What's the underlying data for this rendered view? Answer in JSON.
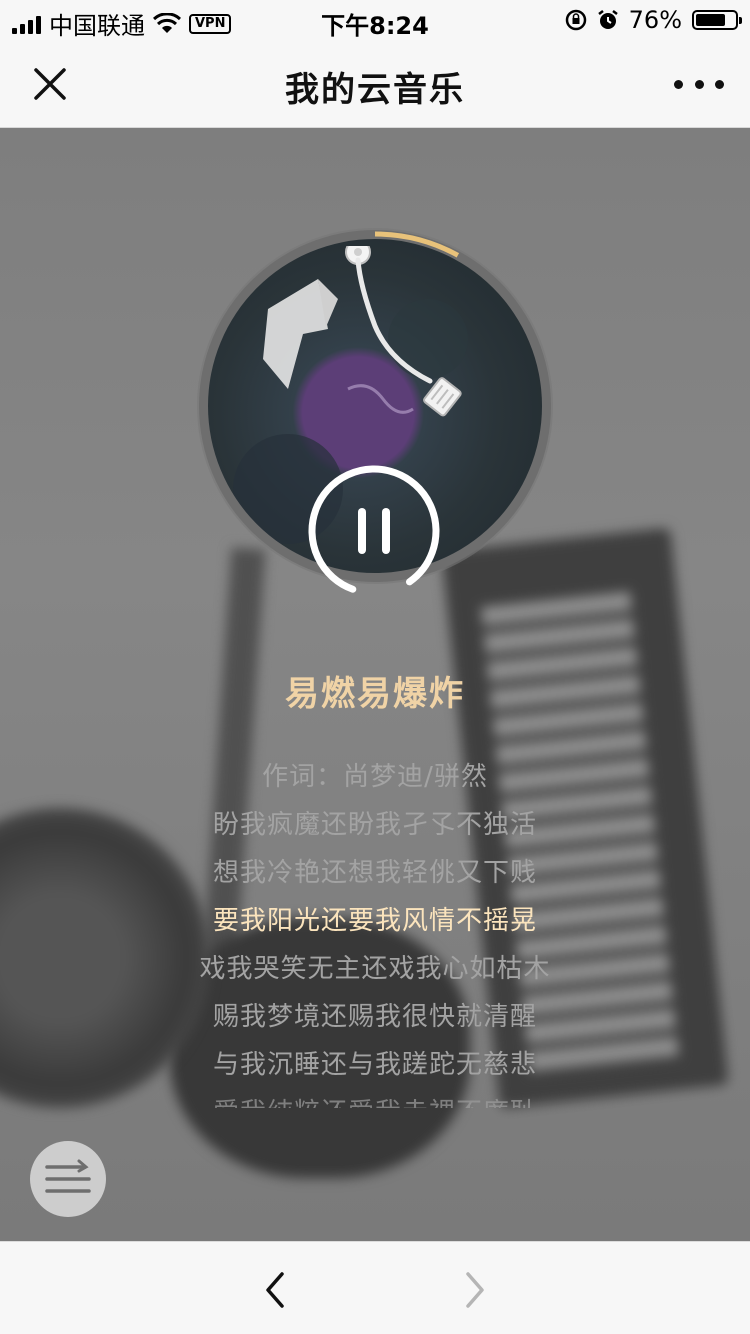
{
  "status_bar": {
    "carrier": "中国联通",
    "vpn": "VPN",
    "time": "下午8:24",
    "battery_text": "76%",
    "battery_level": 0.76
  },
  "nav": {
    "title": "我的云音乐"
  },
  "player": {
    "song_title": "易燃易爆炸",
    "lyrics": [
      "作词：尚梦迪/骈然",
      "盼我疯魔还盼我孑孓不独活",
      "想我冷艳还想我轻佻又下贱",
      "要我阳光还要我风情不摇晃",
      "戏我哭笑无主还戏我心如枯木",
      "赐我梦境还赐我很快就清醒",
      "与我沉睡还与我蹉跎无慈悲",
      "爱我纯粹还爱我赤裸不廉耻"
    ],
    "current_lyric_index": 3,
    "progress_fraction": 0.08
  },
  "colors": {
    "accent_gold": "#f0d3a6",
    "current_lyric": "#fbe4bd",
    "progress_arc": "#e8c27a"
  }
}
